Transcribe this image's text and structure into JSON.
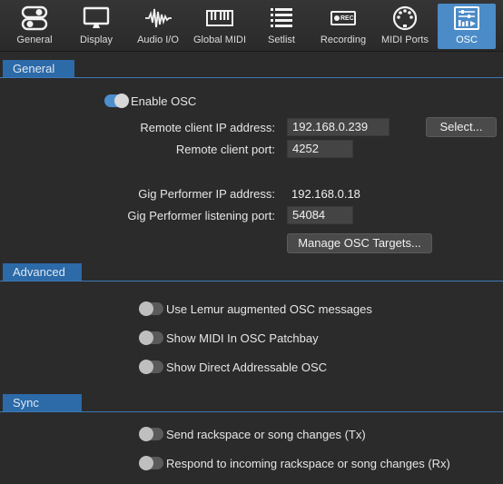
{
  "tabs": [
    {
      "label": "General",
      "icon": "general-toggle-icon"
    },
    {
      "label": "Display",
      "icon": "display-monitor-icon"
    },
    {
      "label": "Audio I/O",
      "icon": "audio-waveform-icon"
    },
    {
      "label": "Global MIDI",
      "icon": "piano-keyboard-icon"
    },
    {
      "label": "Setlist",
      "icon": "setlist-icon"
    },
    {
      "label": "Recording",
      "icon": "rec-icon"
    },
    {
      "label": "MIDI Ports",
      "icon": "midi-port-icon"
    },
    {
      "label": "OSC",
      "icon": "osc-sliders-icon"
    }
  ],
  "rec_badge": "REC",
  "sections": {
    "general": "General",
    "advanced": "Advanced",
    "sync": "Sync"
  },
  "general": {
    "enable_osc": "Enable OSC",
    "remote_ip_label": "Remote client IP address:",
    "remote_ip_value": "192.168.0.239",
    "select_button": "Select...",
    "remote_port_label": "Remote client port:",
    "remote_port_value": "4252",
    "gp_ip_label": "Gig Performer IP address:",
    "gp_ip_value": "192.168.0.18",
    "gp_port_label": "Gig Performer listening port:",
    "gp_port_value": "54084",
    "manage_button": "Manage OSC Targets..."
  },
  "advanced": {
    "lemur": "Use Lemur augmented OSC messages",
    "midi_in": "Show MIDI In OSC Patchbay",
    "direct": "Show Direct Addressable OSC"
  },
  "sync": {
    "send": "Send rackspace or song changes (Tx)",
    "respond": "Respond to incoming rackspace or song changes (Rx)"
  },
  "colors": {
    "accent": "#4b8bc7",
    "section": "#2c6aa8",
    "background": "#2b2b2b"
  },
  "toggles": {
    "enable_osc": true,
    "lemur": false,
    "midi_in": false,
    "direct": false,
    "send": false,
    "respond": false
  }
}
